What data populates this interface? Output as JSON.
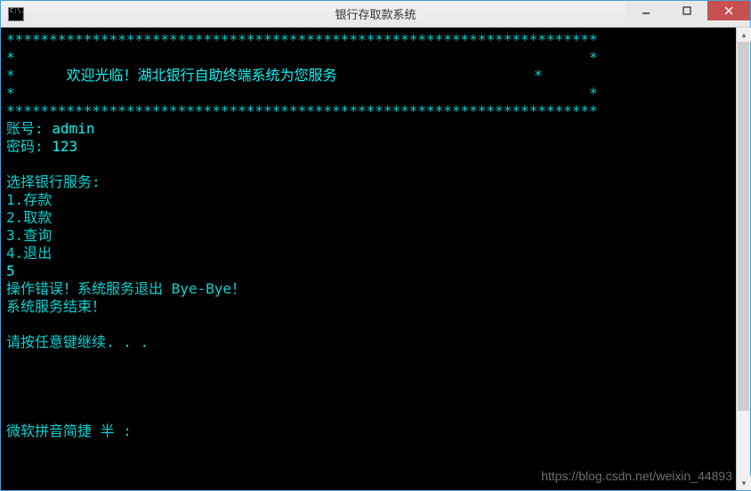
{
  "window": {
    "title": "银行存取款系统",
    "icon_text": "C:\\."
  },
  "console": {
    "border_line": "*********************************************************************",
    "border_empty_left": "*",
    "border_empty_right": "*",
    "welcome_text": "欢迎光临！湖北银行自助终端系统为您服务",
    "account_label": "账号:",
    "account_value": "admin",
    "password_label": "密码:",
    "password_value": "123",
    "menu_title": "选择银行服务:",
    "menu_item_1": "1.存款",
    "menu_item_2": "2.取款",
    "menu_item_3": "3.查询",
    "menu_item_4": "4.退出",
    "user_input": "5",
    "error_msg": "操作错误！系统服务退出 Bye-Bye！",
    "exit_msg": "系统服务结束！",
    "continue_prompt": "请按任意键继续. . .",
    "ime_status": "微软拼音简捷 半 :"
  },
  "watermark": "https://blog.csdn.net/weixin_44893"
}
